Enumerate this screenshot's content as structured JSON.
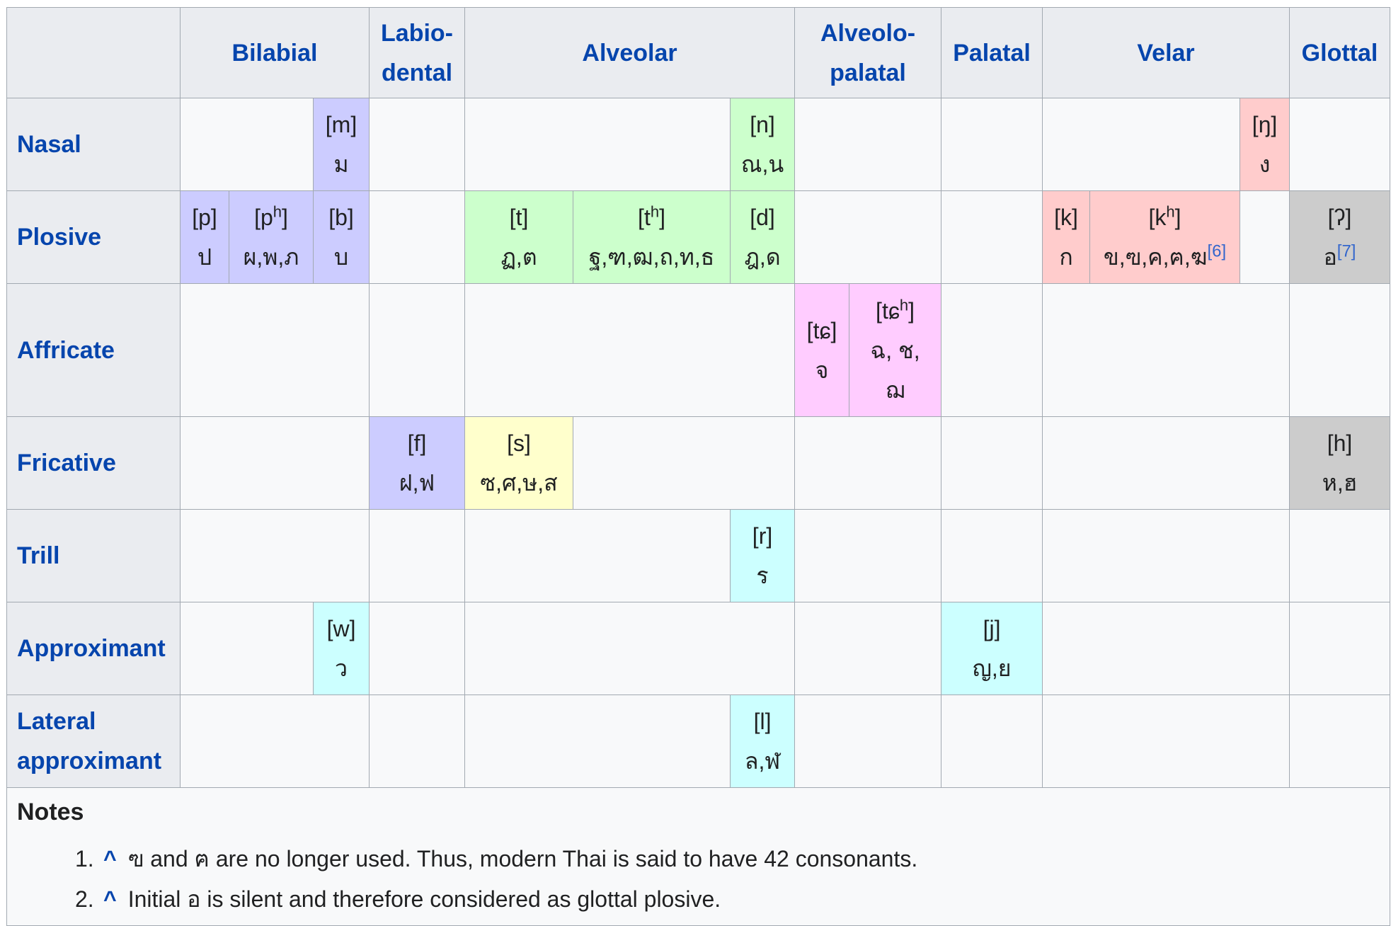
{
  "header": {
    "corner": "",
    "columns": [
      {
        "lines": [
          "Bilabial"
        ],
        "span": 3
      },
      {
        "lines": [
          "Labio-",
          "dental"
        ],
        "span": 1
      },
      {
        "lines": [
          "Alveolar"
        ],
        "span": 3
      },
      {
        "lines": [
          "Alveolo-",
          "palatal"
        ],
        "span": 2
      },
      {
        "lines": [
          "Palatal"
        ],
        "span": 1
      },
      {
        "lines": [
          "Velar"
        ],
        "span": 3
      },
      {
        "lines": [
          "Glottal"
        ],
        "span": 1
      }
    ]
  },
  "rows": [
    {
      "label_lines": [
        "Nasal"
      ],
      "cells": [
        {
          "span": 2
        },
        {
          "ipa": "[m]",
          "thai": "ม",
          "color": "purple"
        },
        {
          "span": 1
        },
        {
          "span": 2
        },
        {
          "ipa": "[n]",
          "thai": "ณ,น",
          "color": "green"
        },
        {
          "span": 2
        },
        {
          "span": 1
        },
        {
          "span": 2
        },
        {
          "ipa": "[ŋ]",
          "thai": "ง",
          "color": "red"
        },
        {
          "span": 1
        }
      ]
    },
    {
      "label_lines": [
        "Plosive"
      ],
      "cells": [
        {
          "ipa": "[p]",
          "thai": "ป",
          "color": "purple"
        },
        {
          "ipa": "[p",
          "ipa_sup": "h",
          "ipa_end": "]",
          "thai": "ผ,พ,ภ",
          "color": "purple"
        },
        {
          "ipa": "[b]",
          "thai": "บ",
          "color": "purple"
        },
        {
          "span": 1
        },
        {
          "ipa": "[t]",
          "thai": "ฏ,ต",
          "color": "green"
        },
        {
          "ipa": "[t",
          "ipa_sup": "h",
          "ipa_end": "]",
          "thai": "ฐ,ฑ,ฒ,ถ,ท,ธ",
          "color": "green"
        },
        {
          "ipa": "[d]",
          "thai": "ฎ,ด",
          "color": "green"
        },
        {
          "span": 2
        },
        {
          "span": 1
        },
        {
          "ipa": "[k]",
          "thai": "ก",
          "color": "red"
        },
        {
          "ipa": "[k",
          "ipa_sup": "h",
          "ipa_end": "]",
          "thai": "ข,ฃ,ค,ฅ,ฆ",
          "thai_sup": "[6]",
          "color": "red"
        },
        {
          "span": 1
        },
        {
          "ipa": "[ʔ]",
          "thai": "อ",
          "thai_sup": "[7]",
          "color": "gray"
        }
      ]
    },
    {
      "label_lines": [
        "Affricate"
      ],
      "cells": [
        {
          "span": 3
        },
        {
          "span": 1
        },
        {
          "span": 3
        },
        {
          "ipa": "[tɕ]",
          "thai": "จ",
          "color": "pink"
        },
        {
          "ipa": "[tɕ",
          "ipa_sup": "h",
          "ipa_end": "]",
          "thai_lines": [
            "ฉ, ช,",
            "ฌ"
          ],
          "color": "pink"
        },
        {
          "span": 1
        },
        {
          "span": 3
        },
        {
          "span": 1
        }
      ]
    },
    {
      "label_lines": [
        "Fricative"
      ],
      "cells": [
        {
          "span": 3
        },
        {
          "ipa": "[f]",
          "thai": "ฝ,ฟ",
          "color": "purple"
        },
        {
          "ipa": "[s]",
          "thai": "ซ,ศ,ษ,ส",
          "color": "yellow"
        },
        {
          "span": 2
        },
        {
          "span": 2
        },
        {
          "span": 1
        },
        {
          "span": 3
        },
        {
          "ipa": "[h]",
          "thai": "ห,ฮ",
          "color": "gray"
        }
      ]
    },
    {
      "label_lines": [
        "Trill"
      ],
      "cells": [
        {
          "span": 3
        },
        {
          "span": 1
        },
        {
          "span": 2
        },
        {
          "ipa": "[r]",
          "thai": "ร",
          "color": "cyan"
        },
        {
          "span": 2
        },
        {
          "span": 1
        },
        {
          "span": 3
        },
        {
          "span": 1
        }
      ]
    },
    {
      "label_lines": [
        "Approximant"
      ],
      "cells": [
        {
          "span": 2
        },
        {
          "ipa": "[w]",
          "thai": "ว",
          "color": "cyan"
        },
        {
          "span": 1
        },
        {
          "span": 3
        },
        {
          "span": 2
        },
        {
          "ipa": "[j]",
          "thai": "ญ,ย",
          "color": "cyan"
        },
        {
          "span": 3
        },
        {
          "span": 1
        }
      ]
    },
    {
      "label_lines": [
        "Lateral",
        "approximant"
      ],
      "cells": [
        {
          "span": 3
        },
        {
          "span": 1
        },
        {
          "span": 2
        },
        {
          "ipa": "[l]",
          "thai": "ล,ฬ",
          "color": "cyan"
        },
        {
          "span": 2
        },
        {
          "span": 1
        },
        {
          "span": 3
        },
        {
          "span": 1
        }
      ]
    }
  ],
  "notes": {
    "title": "Notes",
    "items": [
      {
        "number": "1.",
        "caret": "^",
        "text": "ฃ and ฅ are no longer used. Thus, modern Thai is said to have 42 consonants."
      },
      {
        "number": "2.",
        "caret": "^",
        "text": "Initial อ is silent and therefore considered as glottal plosive."
      }
    ]
  },
  "colors": {
    "purple": "#ccccff",
    "green": "#ccffcc",
    "red": "#ffcccc",
    "gray": "#cccccc",
    "pink": "#ffccff",
    "yellow": "#ffffcc",
    "cyan": "#ccffff",
    "header_bg": "#eaecf0",
    "link": "#0645ad",
    "border": "#a2a9b1"
  }
}
